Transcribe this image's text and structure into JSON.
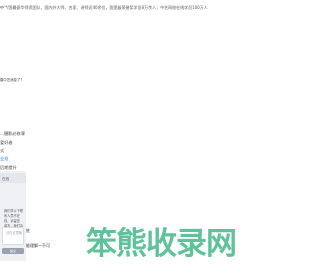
{
  "intro": {
    "prefix": "中",
    "text": "'*/国最豪华师资团队，国内外大师、名家、讲师近40余位，国里级荣誉奖学员8万余人；中艺网校在线学员100万人"
  },
  "question_label": "摄中艺消息了？",
  "menu": {
    "items": [
      {
        "label": "...摄影必修课",
        "active": false
      },
      {
        "label": "爱好者",
        "active": false
      },
      {
        "label": "式",
        "active": false
      },
      {
        "label": "业班",
        "active": true
      },
      {
        "label": "后期提升",
        "active": false
      },
      {
        "label": "摄师",
        "active": false
      }
    ]
  },
  "panel": {
    "head_text": "在线",
    "desc": "我们学以下联系人员不在\n线，请留言\n留言，我们会\n回复。我们会\n电话",
    "placeholder": "请在这里输\n入",
    "button": "提交"
  },
  "side": {
    "label1": "姓",
    "label2": "能理解一不可"
  },
  "watermark": "笨熊收录网"
}
